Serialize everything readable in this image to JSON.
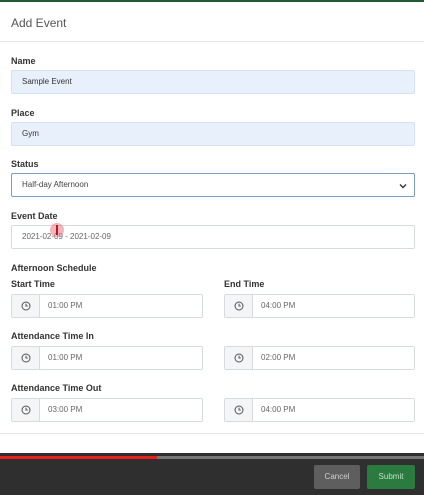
{
  "modal": {
    "title": "Add Event"
  },
  "form": {
    "name": {
      "label": "Name",
      "value": "Sample Event"
    },
    "place": {
      "label": "Place",
      "value": "Gym"
    },
    "status": {
      "label": "Status",
      "value": "Half-day Afternoon"
    },
    "event_date": {
      "label": "Event Date",
      "value": "2021-02-09 - 2021-02-09"
    },
    "afternoon_schedule": {
      "heading": "Afternoon Schedule",
      "start_time": {
        "label": "Start Time",
        "value": "01:00 PM"
      },
      "end_time": {
        "label": "End Time",
        "value": "04:00 PM"
      }
    },
    "attendance_in": {
      "label": "Attendance Time In",
      "from": "01:00 PM",
      "to": "02:00 PM"
    },
    "attendance_out": {
      "label": "Attendance Time Out",
      "from": "03:00 PM",
      "to": "04:00 PM"
    }
  },
  "footer": {
    "cancel_label": "Cancel",
    "submit_label": "Submit"
  },
  "video_progress": {
    "played_fraction": 0.37
  },
  "colors": {
    "header_strip": "#1e5a36",
    "submit": "#2b7a3f",
    "progress": "#e62117",
    "filled_input": "#e8f0fc"
  }
}
